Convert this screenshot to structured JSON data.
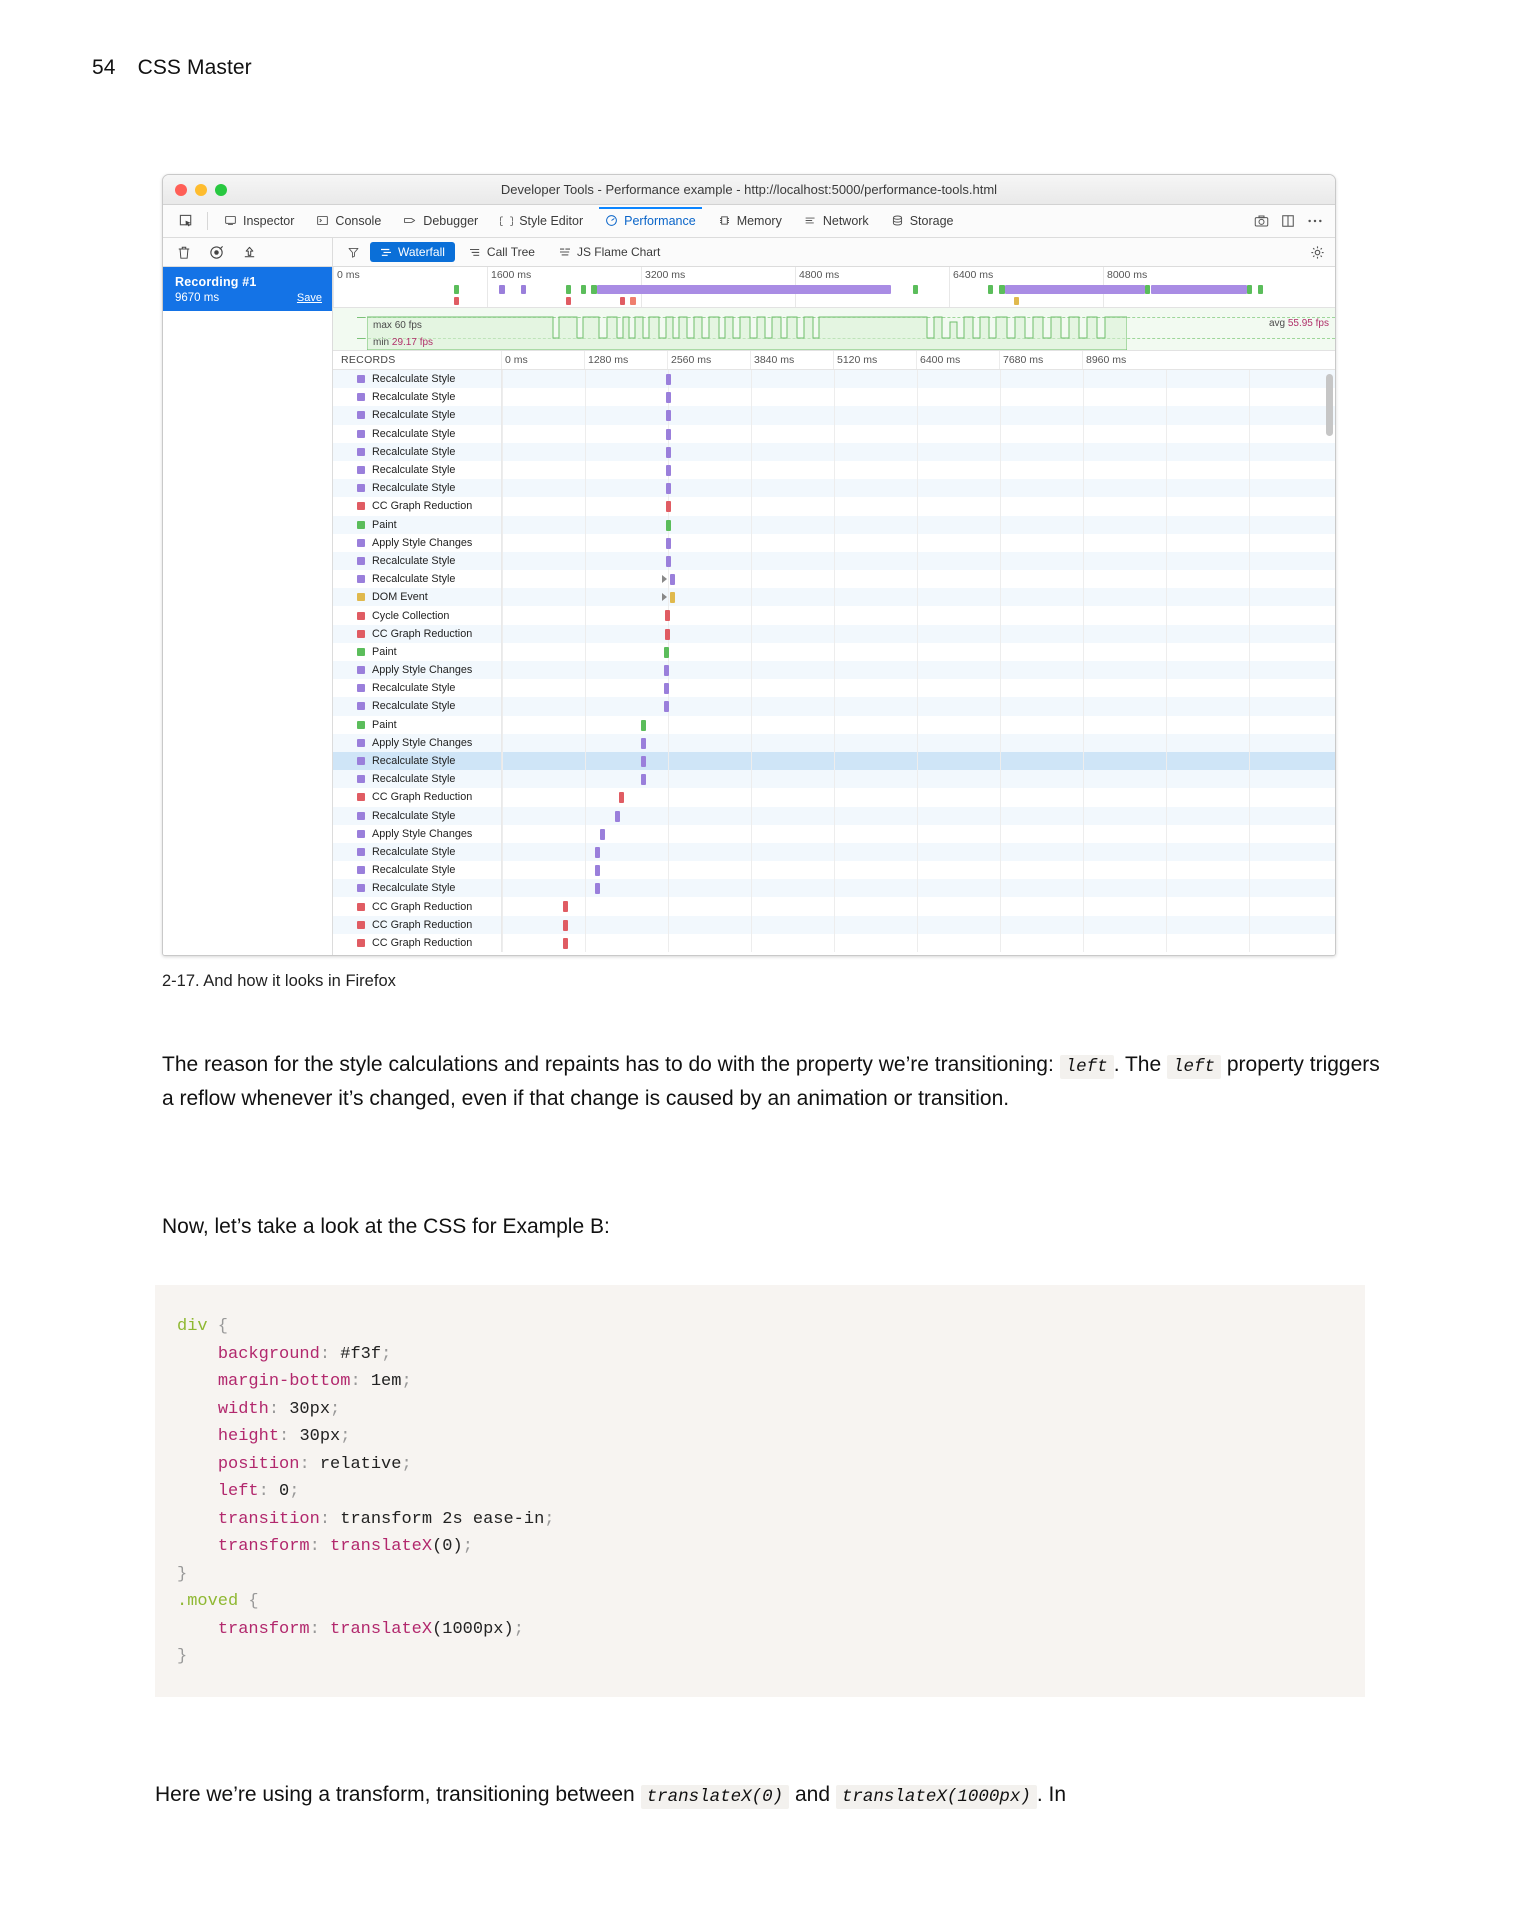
{
  "page": {
    "number": "54",
    "book_title": "CSS Master"
  },
  "figure": {
    "caption": "2-17. And how it looks in Firefox",
    "window": {
      "title": "Developer Tools - Performance example - http://localhost:5000/performance-tools.html",
      "traffic_lights": [
        "close",
        "minimize",
        "zoom"
      ]
    },
    "toolbar": {
      "picker_icon": "element-picker-icon",
      "tabs": [
        {
          "label": "Inspector",
          "icon": "inspector-icon",
          "active": false
        },
        {
          "label": "Console",
          "icon": "console-icon",
          "active": false
        },
        {
          "label": "Debugger",
          "icon": "debugger-icon",
          "active": false
        },
        {
          "label": "Style Editor",
          "icon": "style-editor-icon",
          "active": false
        },
        {
          "label": "Performance",
          "icon": "performance-icon",
          "active": true
        },
        {
          "label": "Memory",
          "icon": "memory-icon",
          "active": false
        },
        {
          "label": "Network",
          "icon": "network-icon",
          "active": false
        },
        {
          "label": "Storage",
          "icon": "storage-icon",
          "active": false
        }
      ],
      "right_icons": [
        "screenshot-icon",
        "responsive-layout-icon",
        "more-options-icon"
      ]
    },
    "perf_toolbar": {
      "left_icons": [
        "trash-icon",
        "record-icon",
        "import-icon"
      ],
      "filter_icon": "filter-icon",
      "views": [
        {
          "label": "Waterfall",
          "icon": "waterfall-icon",
          "active": true
        },
        {
          "label": "Call Tree",
          "icon": "call-tree-icon",
          "active": false
        },
        {
          "label": "JS Flame Chart",
          "icon": "flame-chart-icon",
          "active": false
        }
      ],
      "settings_icon": "gear-icon"
    },
    "recordings": [
      {
        "title": "Recording #1",
        "duration": "9670 ms",
        "save_label": "Save",
        "selected": true
      }
    ],
    "overview_ruler": {
      "ticks": [
        "0 ms",
        "1600 ms",
        "3200 ms",
        "4800 ms",
        "6400 ms",
        "8000 ms"
      ]
    },
    "fps_graph": {
      "max_label": "max",
      "max_value": "60 fps",
      "min_label": "min",
      "min_value": "29.17 fps",
      "avg_label": "avg",
      "avg_value": "55.95 fps"
    },
    "records": {
      "header_label": "RECORDS",
      "scale_ticks": [
        "0 ms",
        "1280 ms",
        "2560 ms",
        "3840 ms",
        "5120 ms",
        "6400 ms",
        "7680 ms",
        "8960 ms"
      ],
      "rows": [
        {
          "label": "CC Graph Reduction",
          "color": "#e05c63",
          "pos": 9.2,
          "w": 0.7,
          "selected": false
        },
        {
          "label": "CC Graph Reduction",
          "color": "#e05c63",
          "pos": 9.2,
          "w": 0.7,
          "selected": false
        },
        {
          "label": "CC Graph Reduction",
          "color": "#e05c63",
          "pos": 9.2,
          "w": 0.7,
          "selected": false
        },
        {
          "label": "Recalculate Style",
          "color": "#9a7fdb",
          "pos": 14.0,
          "w": 0.7,
          "selected": false
        },
        {
          "label": "Recalculate Style",
          "color": "#9a7fdb",
          "pos": 14.0,
          "w": 0.7,
          "selected": false
        },
        {
          "label": "Recalculate Style",
          "color": "#9a7fdb",
          "pos": 14.0,
          "w": 0.7,
          "selected": false
        },
        {
          "label": "Apply Style Changes",
          "color": "#9a7fdb",
          "pos": 14.8,
          "w": 0.7,
          "selected": false
        },
        {
          "label": "Recalculate Style",
          "color": "#9a7fdb",
          "pos": 17.0,
          "w": 0.7,
          "selected": false
        },
        {
          "label": "CC Graph Reduction",
          "color": "#e05c63",
          "pos": 17.6,
          "w": 0.7,
          "selected": false
        },
        {
          "label": "Recalculate Style",
          "color": "#9a7fdb",
          "pos": 21.0,
          "w": 0.7,
          "selected": false
        },
        {
          "label": "Recalculate Style",
          "color": "#9a7fdb",
          "pos": 21.0,
          "w": 0.7,
          "selected": true
        },
        {
          "label": "Apply Style Changes",
          "color": "#9a7fdb",
          "pos": 21.0,
          "w": 0.7,
          "selected": false
        },
        {
          "label": "Paint",
          "color": "#5bbd5b",
          "pos": 21.0,
          "w": 0.7,
          "selected": false
        },
        {
          "label": "Recalculate Style",
          "color": "#9a7fdb",
          "pos": 24.4,
          "w": 0.7,
          "selected": false
        },
        {
          "label": "Recalculate Style",
          "color": "#9a7fdb",
          "pos": 24.4,
          "w": 0.7,
          "selected": false
        },
        {
          "label": "Apply Style Changes",
          "color": "#9a7fdb",
          "pos": 24.4,
          "w": 0.7,
          "selected": false
        },
        {
          "label": "Paint",
          "color": "#5bbd5b",
          "pos": 24.4,
          "w": 0.7,
          "selected": false
        },
        {
          "label": "CC Graph Reduction",
          "color": "#e05c63",
          "pos": 24.6,
          "w": 0.7,
          "selected": false
        },
        {
          "label": "Cycle Collection",
          "color": "#e05c63",
          "pos": 24.6,
          "w": 0.7,
          "selected": false
        },
        {
          "label": "DOM Event",
          "color": "#e0b94d",
          "pos": 25.3,
          "w": 0.7,
          "selected": false
        },
        {
          "label": "Recalculate Style",
          "color": "#9a7fdb",
          "pos": 25.3,
          "w": 0.7,
          "selected": false
        },
        {
          "label": "Recalculate Style",
          "color": "#9a7fdb",
          "pos": 24.7,
          "w": 0.7,
          "selected": false
        },
        {
          "label": "Apply Style Changes",
          "color": "#9a7fdb",
          "pos": 24.7,
          "w": 0.7,
          "selected": false
        },
        {
          "label": "Paint",
          "color": "#5bbd5b",
          "pos": 24.7,
          "w": 0.7,
          "selected": false
        },
        {
          "label": "CC Graph Reduction",
          "color": "#e05c63",
          "pos": 24.7,
          "w": 0.7,
          "selected": false
        },
        {
          "label": "Recalculate Style",
          "color": "#9a7fdb",
          "pos": 24.7,
          "w": 0.7,
          "selected": false
        },
        {
          "label": "Recalculate Style",
          "color": "#9a7fdb",
          "pos": 24.7,
          "w": 0.7,
          "selected": false
        },
        {
          "label": "Recalculate Style",
          "color": "#9a7fdb",
          "pos": 24.7,
          "w": 0.7,
          "selected": false
        },
        {
          "label": "Recalculate Style",
          "color": "#9a7fdb",
          "pos": 24.7,
          "w": 0.7,
          "selected": false
        },
        {
          "label": "Recalculate Style",
          "color": "#9a7fdb",
          "pos": 24.7,
          "w": 0.7,
          "selected": false
        },
        {
          "label": "Recalculate Style",
          "color": "#9a7fdb",
          "pos": 24.7,
          "w": 0.7,
          "selected": false
        },
        {
          "label": "Recalculate Style",
          "color": "#9a7fdb",
          "pos": 24.7,
          "w": 0.7,
          "selected": false
        }
      ]
    }
  },
  "paragraphs": {
    "p1_a": "The reason for the style calculations and repaints has to do with the property we’re transitioning:",
    "p1_code1": "left",
    "p1_b": ". The",
    "p1_code2": "left",
    "p1_c": "property triggers a reflow whenever it’s changed, even if that change is caused by an animation or transition.",
    "p2": "Now, let’s take a look at the CSS for Example B:",
    "p3_a": "Here we’re using a transform, transitioning between",
    "p3_code1": "translateX(0)",
    "p3_b": "and",
    "p3_code2": "translateX(1000px)",
    "p3_c": ". In"
  },
  "code_block": {
    "lines": [
      {
        "selector": "div",
        "brace": " {"
      },
      {
        "prop": "background",
        "value": "#f3f"
      },
      {
        "prop": "margin-bottom",
        "value": "1em"
      },
      {
        "prop": "width",
        "value": "30px"
      },
      {
        "prop": "height",
        "value": "30px"
      },
      {
        "prop": "position",
        "value": "relative"
      },
      {
        "prop": "left",
        "value": "0"
      },
      {
        "prop": "transition",
        "value": "transform 2s ease-in"
      },
      {
        "prop": "transform",
        "value": "translateX(0)"
      },
      {
        "close": "}"
      },
      {
        "selector": ".moved",
        "brace": " {"
      },
      {
        "prop": "transform",
        "value": "translateX(1000px)"
      },
      {
        "close": "}"
      }
    ]
  },
  "colors": {
    "accent_blue": "#1473e6",
    "tab_active": "#0a65c9",
    "record_purple": "#9a7fdb",
    "record_red": "#e05c63",
    "record_green": "#5bbd5b",
    "record_yellow": "#e0b94d",
    "fps_green": "#7cc179",
    "code_bg": "#f7f4f1"
  }
}
